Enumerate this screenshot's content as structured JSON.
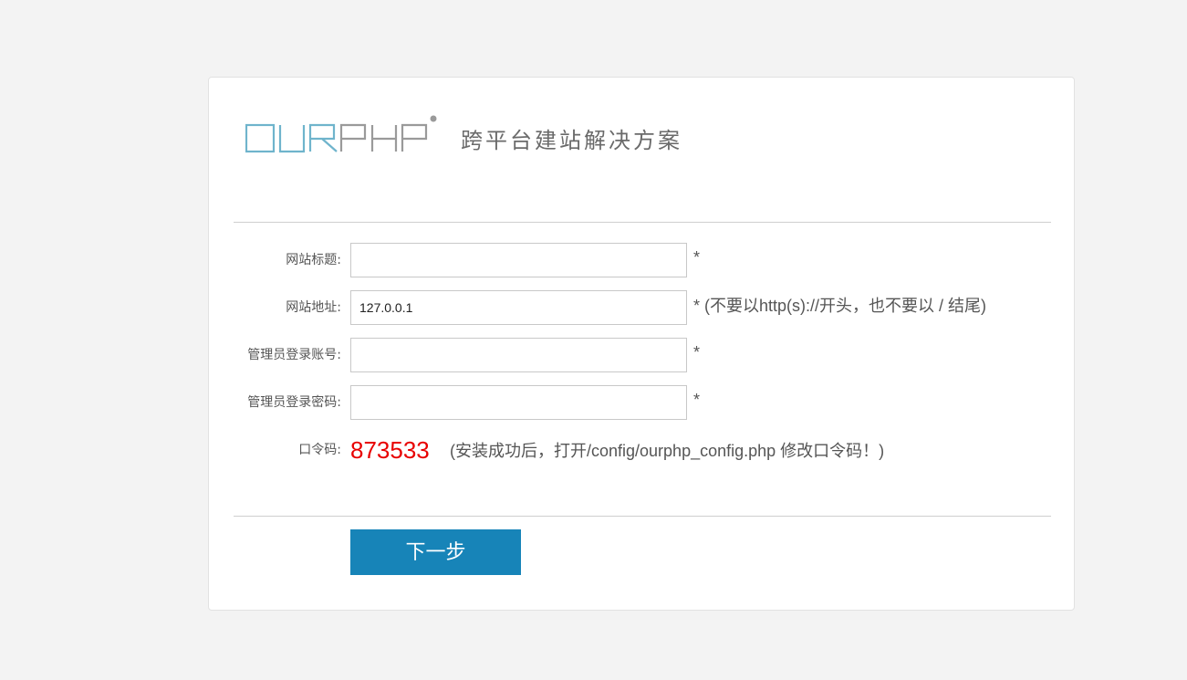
{
  "logo": {
    "text": "OURPHP",
    "registered_mark": "®",
    "slogan": "跨平台建站解决方案",
    "color_accent": "#6fb4cc",
    "color_gray": "#9a9a9a"
  },
  "form": {
    "site_title": {
      "label": "网站标题:",
      "value": "",
      "hint": "*"
    },
    "site_url": {
      "label": "网站地址:",
      "value": "127.0.0.1",
      "hint": "* (不要以http(s)://开头，也不要以 / 结尾)"
    },
    "admin_account": {
      "label": "管理员登录账号:",
      "value": "",
      "hint": "*"
    },
    "admin_password": {
      "label": "管理员登录密码:",
      "value": "",
      "hint": "*"
    },
    "passcode": {
      "label": "口令码:",
      "value": "873533",
      "note": "(安装成功后，打开/config/ourphp_config.php 修改口令码！)",
      "color": "#e80000"
    }
  },
  "actions": {
    "next_label": "下一步",
    "next_color": "#1784b8"
  }
}
